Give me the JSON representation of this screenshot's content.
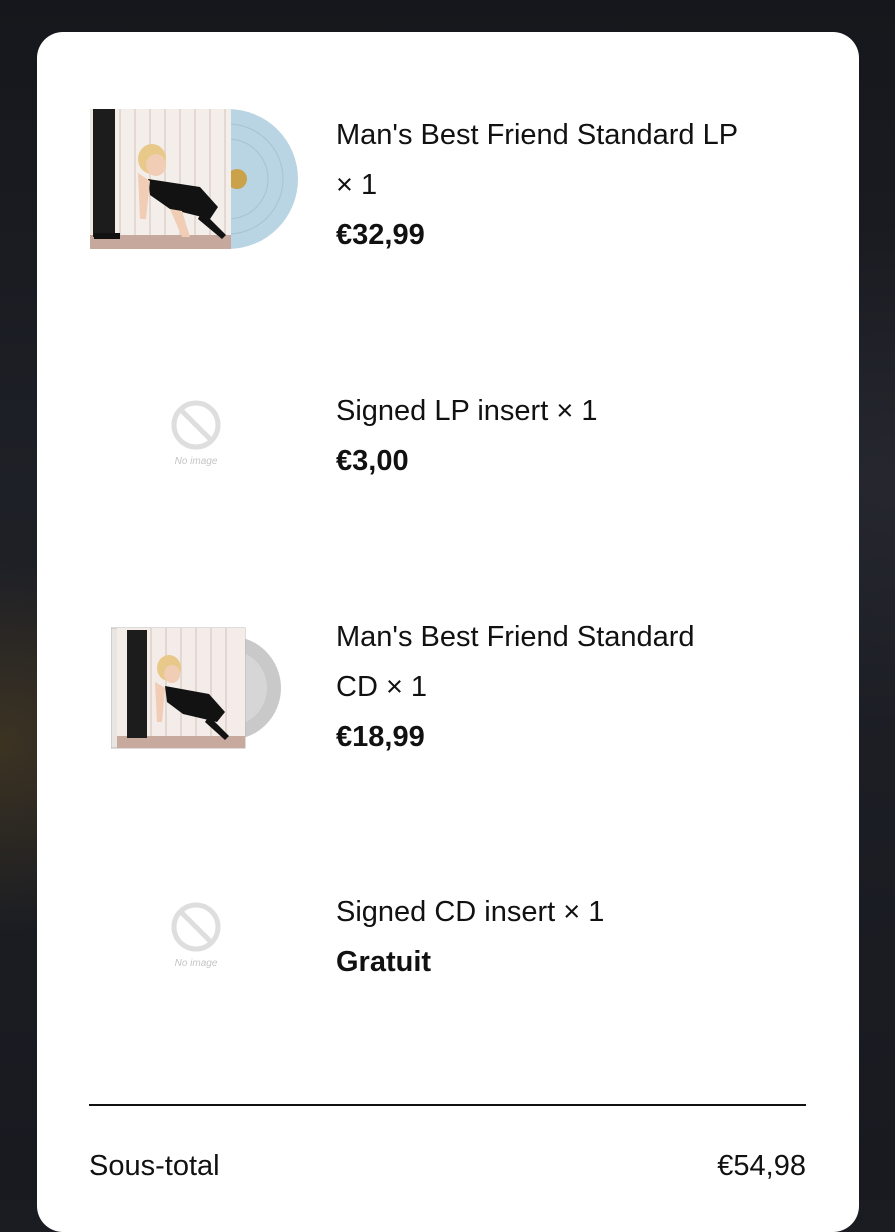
{
  "items": [
    {
      "name": "Man's Best Friend Standard LP",
      "qty": "× 1",
      "price": "€32,99",
      "image": "vinyl-lp-cover"
    },
    {
      "name": "Signed LP insert",
      "qty": "× 1",
      "price": "€3,00",
      "image": "no-image-placeholder",
      "placeholder_text": "No image"
    },
    {
      "name": "Man's Best Friend Standard",
      "qty": "CD × 1",
      "price": "€18,99",
      "image": "cd-cover"
    },
    {
      "name": "Signed CD insert",
      "qty": "× 1",
      "price": "Gratuit",
      "image": "no-image-placeholder",
      "placeholder_text": "No image"
    }
  ],
  "summary": {
    "subtotal_label": "Sous-total",
    "subtotal_value": "€54,98"
  },
  "colors": {
    "card": "#ffffff",
    "text": "#111111",
    "vinyl": "#b9d4e3",
    "cd": "#c9c9c9",
    "placeholder": "#dedede"
  }
}
